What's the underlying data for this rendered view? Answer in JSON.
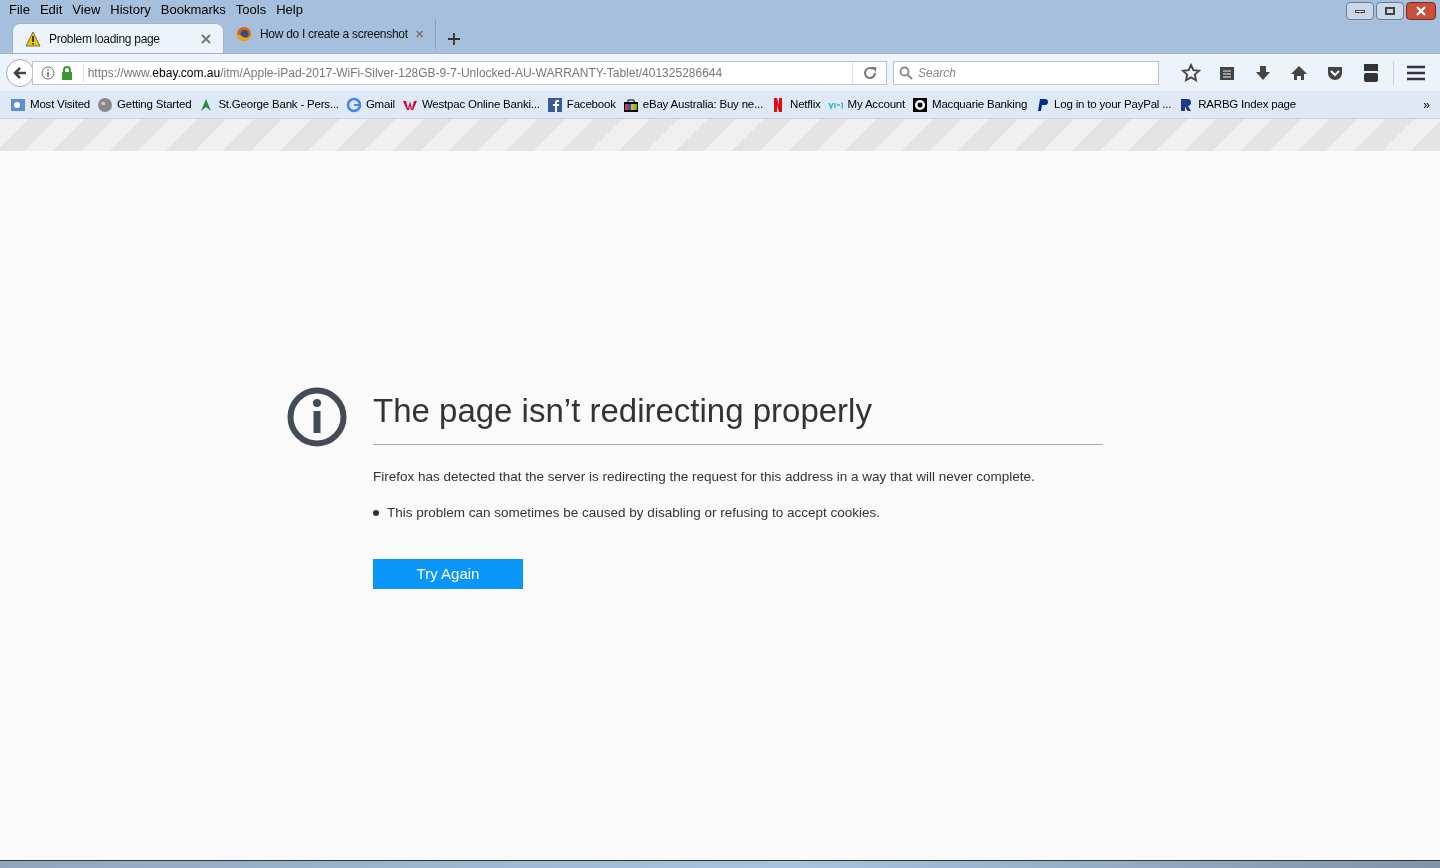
{
  "menu": [
    "File",
    "Edit",
    "View",
    "History",
    "Bookmarks",
    "Tools",
    "Help"
  ],
  "tabs": [
    {
      "title": "Problem loading page",
      "selected": true,
      "kind": "warning"
    },
    {
      "title": "How do I create a screenshot",
      "selected": false,
      "kind": "firefox"
    }
  ],
  "address": {
    "prefix": "https://www.",
    "domain": "ebay.com.au",
    "path": "/itm/Apple-iPad-2017-WiFi-Silver-128GB-9-7-Unlocked-AU-WARRANTY-Tablet/401325286644"
  },
  "search": {
    "placeholder": "Search"
  },
  "bookmarks": [
    "Most Visited",
    "Getting Started",
    "St.George Bank - Pers...",
    "Gmail",
    "Westpac Online Banki...",
    "Facebook",
    "eBay Australia: Buy ne...",
    "Netflix",
    "My Account",
    "Macquarie Banking",
    "Log in to your PayPal ...",
    "RARBG Index page"
  ],
  "overflow": "»",
  "error": {
    "title": "The page isn’t redirecting properly",
    "description": "Firefox has detected that the server is redirecting the request for this address in a way that will never complete.",
    "hints": [
      "This problem can sometimes be caused by disabling or refusing to accept cookies."
    ],
    "button": "Try Again"
  }
}
